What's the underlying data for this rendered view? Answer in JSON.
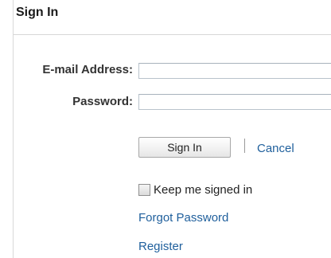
{
  "form": {
    "title": "Sign In",
    "email_label": "E-mail Address:",
    "email_value": "",
    "password_label": "Password:",
    "password_value": "",
    "sign_in_button": "Sign In",
    "cancel_link": "Cancel",
    "keep_signed_in_label": "Keep me signed in",
    "keep_signed_in_checked": false,
    "forgot_password_link": "Forgot Password",
    "register_link": "Register"
  },
  "colors": {
    "link": "#1f5f9c",
    "border": "#d6d6d6"
  }
}
